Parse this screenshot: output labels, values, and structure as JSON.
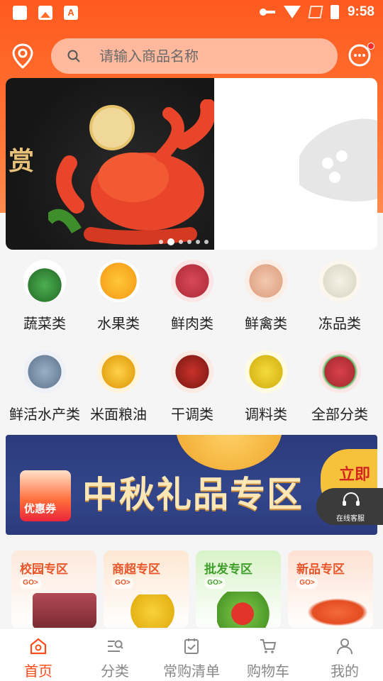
{
  "status_bar": {
    "time": "9:58"
  },
  "header": {
    "search_placeholder": "请输入商品名称",
    "icons": {
      "location": "location-pin-icon",
      "message": "chat-bubble-icon",
      "search": "search-icon"
    }
  },
  "banner": {
    "overlay_text": "赏",
    "slide_count": 6,
    "active_slide": 1
  },
  "categories": [
    {
      "label": "蔬菜类",
      "icon": "vegetables",
      "color": "#3aa33a"
    },
    {
      "label": "水果类",
      "icon": "mango",
      "color": "#f7b21e"
    },
    {
      "label": "鲜肉类",
      "icon": "meat",
      "color": "#c8384a"
    },
    {
      "label": "鲜禽类",
      "icon": "poultry",
      "color": "#e8b29a"
    },
    {
      "label": "冻品类",
      "icon": "dumplings",
      "color": "#e9e5d6"
    },
    {
      "label": "鲜活水产类",
      "icon": "fish",
      "color": "#8aa0b6"
    },
    {
      "label": "米面粮油",
      "icon": "oil",
      "color": "#f0b820"
    },
    {
      "label": "干调类",
      "icon": "chili",
      "color": "#b32a22"
    },
    {
      "label": "调料类",
      "icon": "seasoning",
      "color": "#f1d23a"
    },
    {
      "label": "全部分类",
      "icon": "all",
      "color": "#c0392b"
    }
  ],
  "promo": {
    "title": "中秋礼品专区",
    "coupon_label": "优惠券",
    "right_text": "立即"
  },
  "customer_service": {
    "label": "在线客服"
  },
  "zones": [
    {
      "title": "校园专区",
      "go": "GO>",
      "bg": "#fde9dc",
      "color": "#e8562a"
    },
    {
      "title": "商超专区",
      "go": "GO>",
      "bg": "#fde7d2",
      "color": "#e8562a"
    },
    {
      "title": "批发专区",
      "go": "GO>",
      "bg": "#d8f3c8",
      "color": "#3f9e2a"
    },
    {
      "title": "新品专区",
      "go": "GO>",
      "bg": "#fde1d2",
      "color": "#e8562a"
    }
  ],
  "tabbar": [
    {
      "label": "首页",
      "icon": "home-icon",
      "active": true
    },
    {
      "label": "分类",
      "icon": "category-search-icon",
      "active": false
    },
    {
      "label": "常购清单",
      "icon": "clipboard-check-icon",
      "active": false
    },
    {
      "label": "购物车",
      "icon": "cart-icon",
      "active": false
    },
    {
      "label": "我的",
      "icon": "user-icon",
      "active": false
    }
  ],
  "theme": {
    "primary": "#ff5a1f",
    "active_tab": "#ff4a1a"
  }
}
